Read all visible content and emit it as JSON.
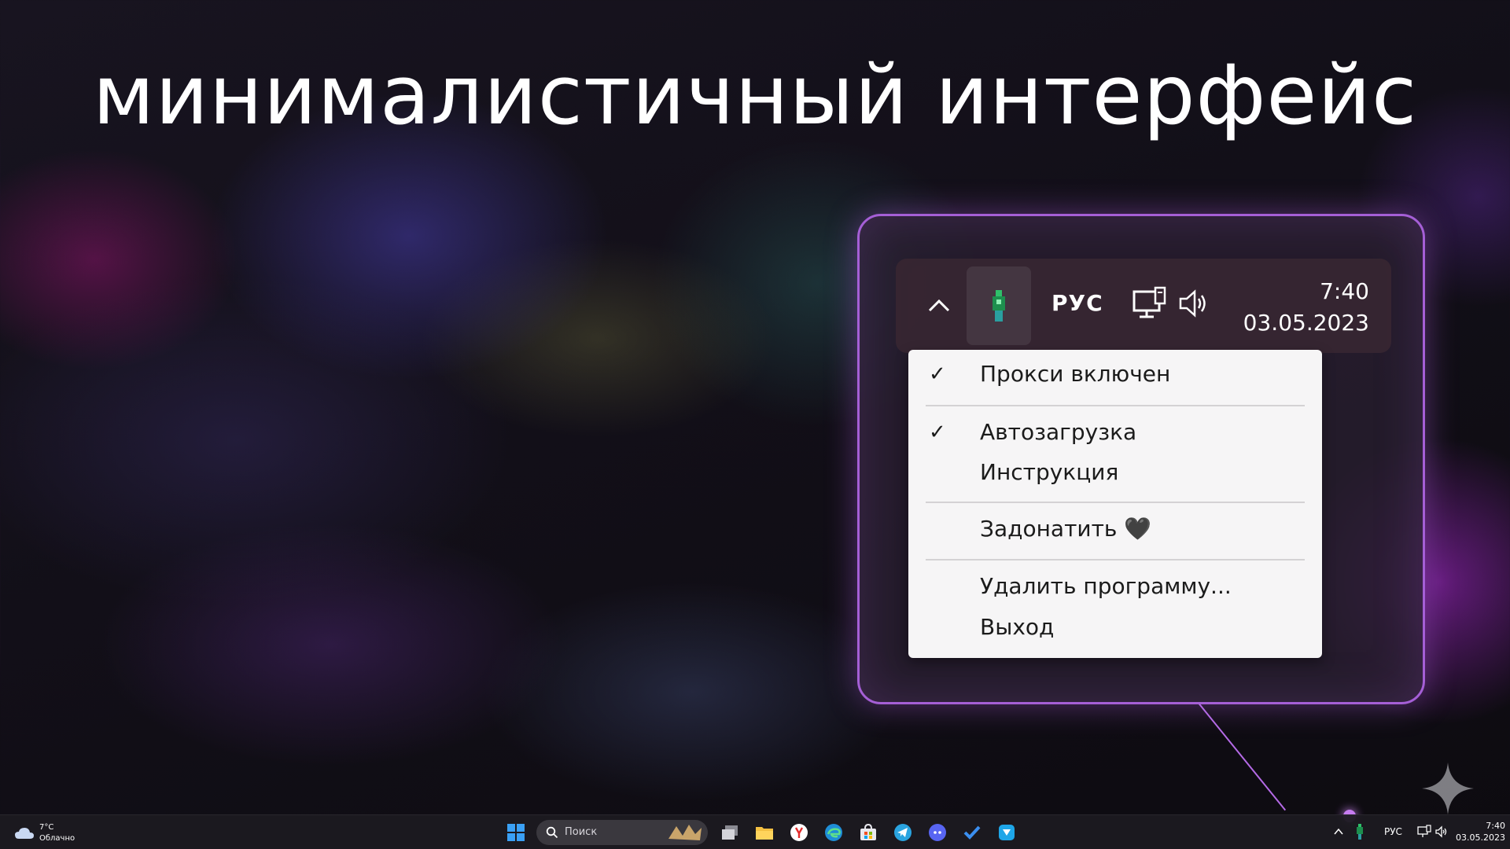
{
  "headline": "минималистичный интерфейс",
  "tray_zoom": {
    "chevron_icon": "chevron-up-icon",
    "app_icon": "proxy-app-icon",
    "language": "РУС",
    "network_icon": "network-monitor-icon",
    "volume_icon": "speaker-icon",
    "time": "7:40",
    "date": "03.05.2023"
  },
  "context_menu": {
    "items": [
      {
        "label": "Прокси включен",
        "checked": true
      },
      {
        "label": "Автозагрузка",
        "checked": true
      },
      {
        "label": "Инструкция",
        "checked": false
      },
      {
        "label": "Задонатить 🖤",
        "checked": false
      },
      {
        "label": "Удалить программу...",
        "checked": false
      },
      {
        "label": "Выход",
        "checked": false
      }
    ],
    "check_glyph": "✓"
  },
  "taskbar": {
    "weather": {
      "temp": "7°C",
      "desc": "Облачно"
    },
    "search_placeholder": "Поиск",
    "pinned_icons": [
      "windows-start-icon",
      "task-view-icon",
      "file-explorer-icon",
      "yandex-browser-icon",
      "edge-icon",
      "microsoft-store-icon",
      "telegram-icon",
      "discord-icon",
      "todo-icon",
      "app-icon"
    ],
    "tray": {
      "language": "РУС",
      "time": "7:40",
      "date": "03.05.2023"
    }
  },
  "colors": {
    "accent": "#a55fd6",
    "menu_bg": "#f6f5f6",
    "taskbar_bg": "#1c1a20"
  }
}
